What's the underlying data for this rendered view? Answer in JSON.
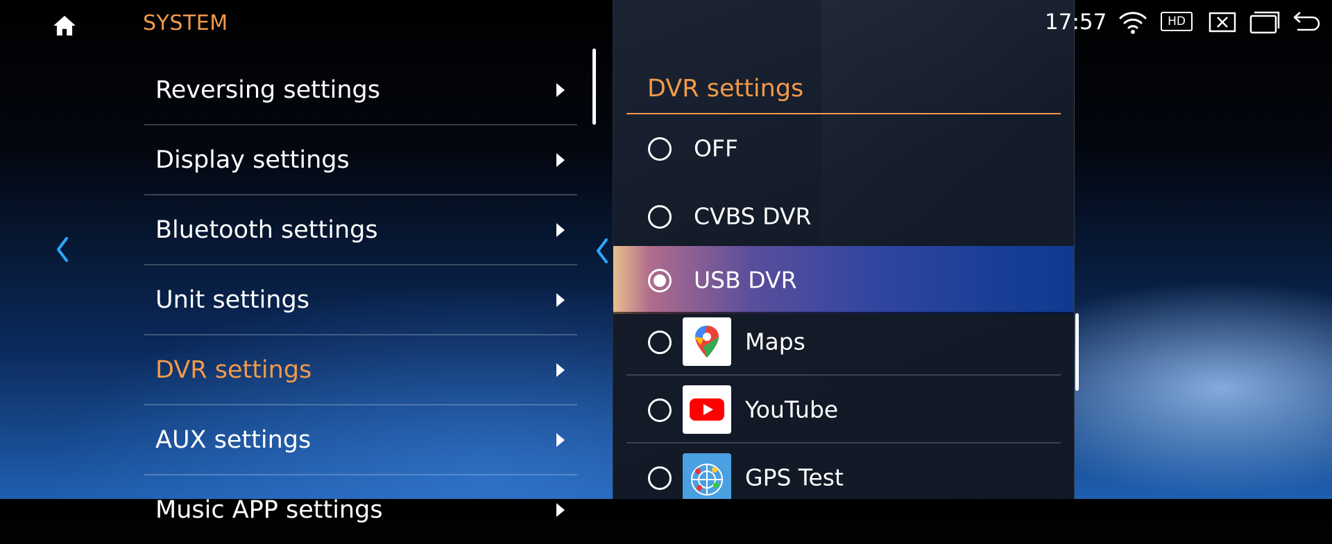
{
  "header": {
    "section_title": "SYSTEM",
    "clock": "17:57",
    "hd_label": "HD"
  },
  "menu": {
    "items": [
      {
        "label": "Reversing settings",
        "active": false
      },
      {
        "label": "Display settings",
        "active": false
      },
      {
        "label": "Bluetooth settings",
        "active": false
      },
      {
        "label": "Unit settings",
        "active": false
      },
      {
        "label": "DVR settings",
        "active": true
      },
      {
        "label": "AUX settings",
        "active": false
      },
      {
        "label": "Music APP settings",
        "active": false
      }
    ]
  },
  "panel": {
    "title": "DVR settings",
    "options": [
      {
        "label": "OFF",
        "selected": false,
        "icon": null
      },
      {
        "label": "CVBS DVR",
        "selected": false,
        "icon": null
      },
      {
        "label": "USB DVR",
        "selected": true,
        "icon": null
      },
      {
        "label": "Maps",
        "selected": false,
        "icon": "google-maps-icon"
      },
      {
        "label": "YouTube",
        "selected": false,
        "icon": "youtube-icon"
      },
      {
        "label": "GPS Test",
        "selected": false,
        "icon": "gps-test-icon"
      }
    ]
  },
  "colors": {
    "accent": "#f29a4a",
    "selected_gradient_start": "#e8c08e",
    "selected_gradient_end": "#0f3a91"
  }
}
